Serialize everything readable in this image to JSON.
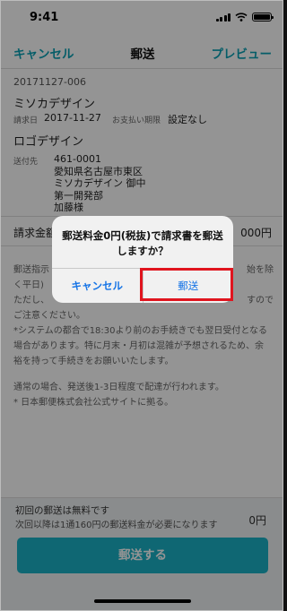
{
  "status_bar": {
    "time": "9:41",
    "icons": [
      "signal-icon",
      "wifi-icon",
      "battery-icon"
    ]
  },
  "nav": {
    "cancel_label": "キャンセル",
    "title": "郵送",
    "preview_label": "プレビュー"
  },
  "invoice": {
    "number": "20171127-006",
    "customer": "ミソカデザイン",
    "issue_date_label": "請求日",
    "issue_date": "2017-11-27",
    "due_label": "お支払い期限",
    "due_value": "設定なし",
    "project": "ロゴデザイン",
    "address_label": "送付先",
    "address_lines": [
      "461-0001",
      "愛知県名古屋市東区",
      "ミソカデザイン 御中",
      "第一開発部",
      "加藤様"
    ]
  },
  "amount": {
    "label_visible": "請求金額",
    "value_visible": "000円"
  },
  "notes": {
    "line1_start": "郵送指示",
    "line1_end": "始を除",
    "line2": "く平日)",
    "line3_start": "ただし、",
    "line3_end": "すので",
    "line4": "ご注意ください。",
    "line5": "*システムの都合で18:30より前のお手続きでも翌日受付となる",
    "line6": "場合があります。特に月末・月初は混雑が予想されるため、余",
    "line7": "裕を持って手続きをお願いいたします。",
    "line8": "通常の場合、発送後1-3日程度で配達が行われます。",
    "line9": "* 日本郵便株式会社公式サイトに拠る。"
  },
  "footer": {
    "free_note": "初回の郵送は無料です",
    "fee_note": "次回以降は1通160円の郵送料金が必要になります",
    "fee_amount": "0円",
    "send_button": "郵送する"
  },
  "alert": {
    "message": "郵送料金0円(税抜)で請求書を郵送しますか？",
    "cancel_label": "キャンセル",
    "confirm_label": "郵送"
  },
  "colors": {
    "accent": "#1ab2c6",
    "alert_button": "#1473e6",
    "highlight": "#e0141e"
  }
}
